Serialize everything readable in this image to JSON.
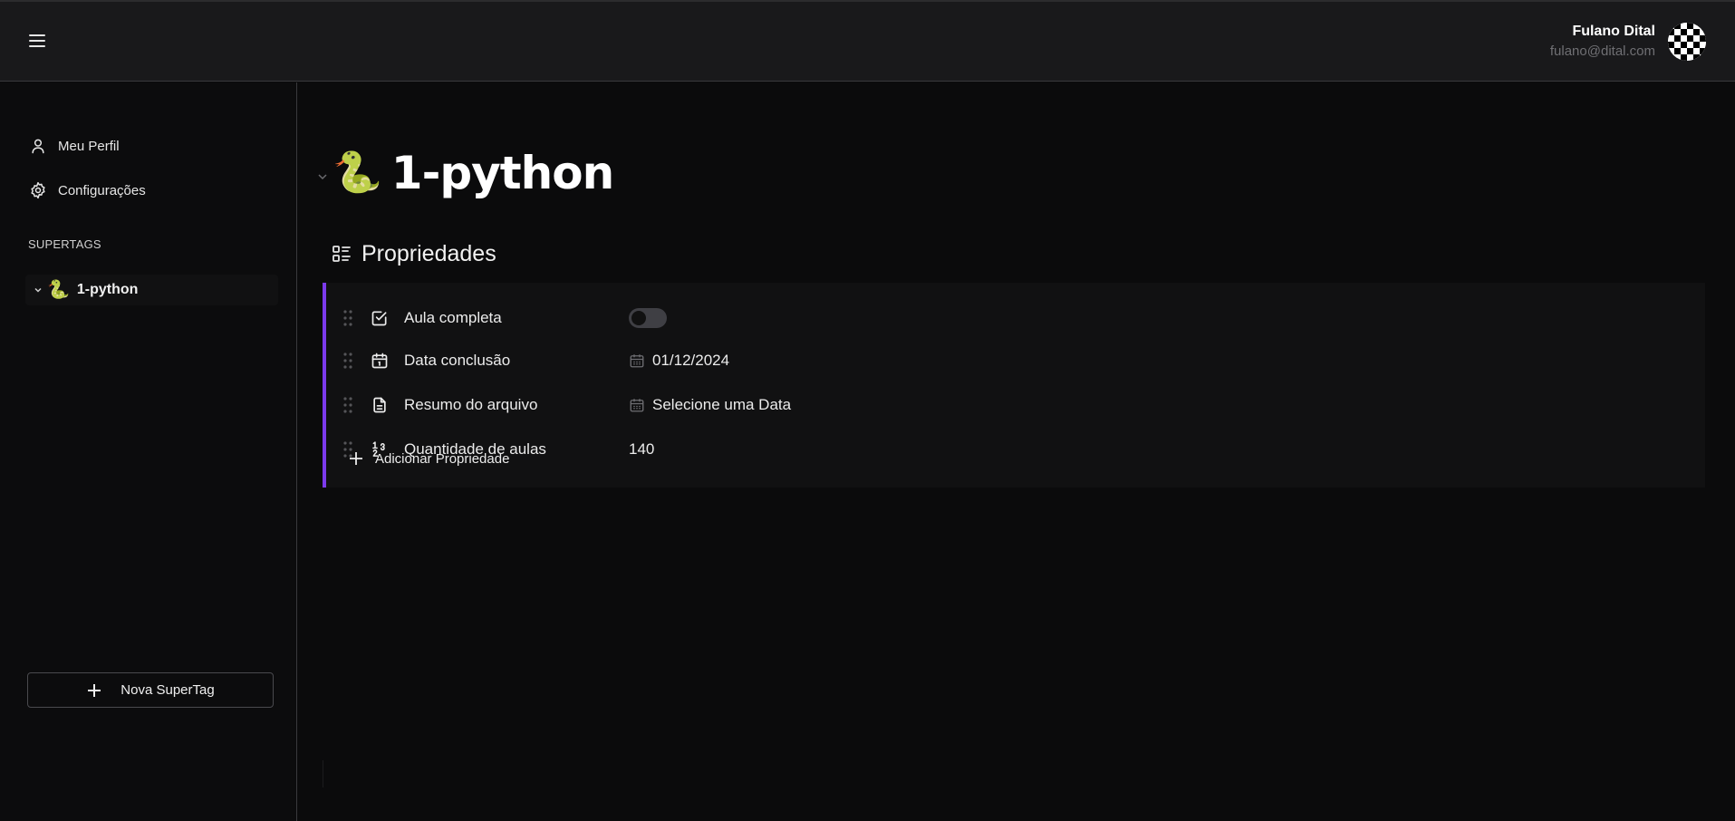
{
  "header": {
    "menu_icon": "hamburger-menu-icon",
    "user_name": "Fulano Dital",
    "user_email": "fulano@dital.com",
    "avatar_icon": "checkerboard-avatar-icon"
  },
  "sidebar": {
    "nav": [
      {
        "label": "Meu Perfil",
        "icon": "user-icon"
      },
      {
        "label": "Configurações",
        "icon": "gear-icon"
      }
    ],
    "section_title": "SUPERTAGS",
    "tags": [
      {
        "emoji": "🐍",
        "label": "1-python",
        "expanded": true
      }
    ],
    "new_tag_label": "Nova SuperTag"
  },
  "main": {
    "emoji": "🐍",
    "title": "1-python",
    "properties_title": "Propriedades",
    "properties": [
      {
        "name": "Aula completa",
        "icon": "checkbox-icon",
        "type": "toggle",
        "value": false
      },
      {
        "name": "Data conclusão",
        "icon": "calendar-icon",
        "type": "date",
        "value": "01/12/2024"
      },
      {
        "name": "Resumo do arquivo",
        "icon": "document-icon",
        "type": "date",
        "value": "Selecione uma Data"
      },
      {
        "name": "Quantidade de aulas",
        "icon": "number-icon",
        "type": "number",
        "value": "140"
      }
    ],
    "add_property_label": "Adicionar Propriedade"
  },
  "colors": {
    "accent": "#7c3aed",
    "background": "#0b0b0c",
    "topbar": "#19191b",
    "panel": "#111112"
  }
}
